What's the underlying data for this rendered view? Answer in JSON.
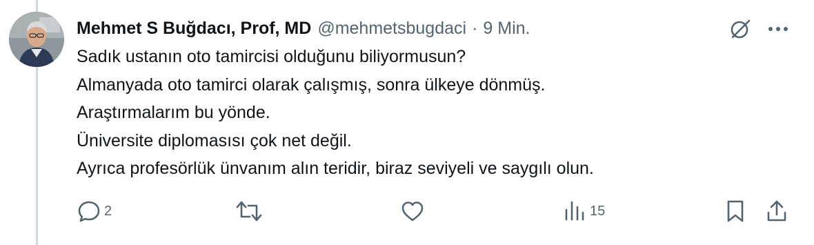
{
  "tweet": {
    "author_name": "Mehmet S Buğdacı, Prof, MD",
    "handle": "@mehmetsbugdaci",
    "separator": "·",
    "time": "9 Min.",
    "lines": [
      "Sadık ustanın oto tamircisi olduğunu biliyormusun?",
      "Almanyada oto tamirci olarak çalışmış, sonra ülkeye dönmüş.",
      "Araştırmalarım bu yönde.",
      "Üniversite diplomasısı çok net değil.",
      "Ayrıca profesörlük ünvanım alın teridir, biraz seviyeli ve saygılı olun."
    ]
  },
  "actions": {
    "reply_count": "2",
    "repost_count": "",
    "like_count": "",
    "views_count": "15"
  },
  "colors": {
    "text": "#0f1419",
    "secondary": "#536471",
    "thread_line": "#cfd9de"
  }
}
